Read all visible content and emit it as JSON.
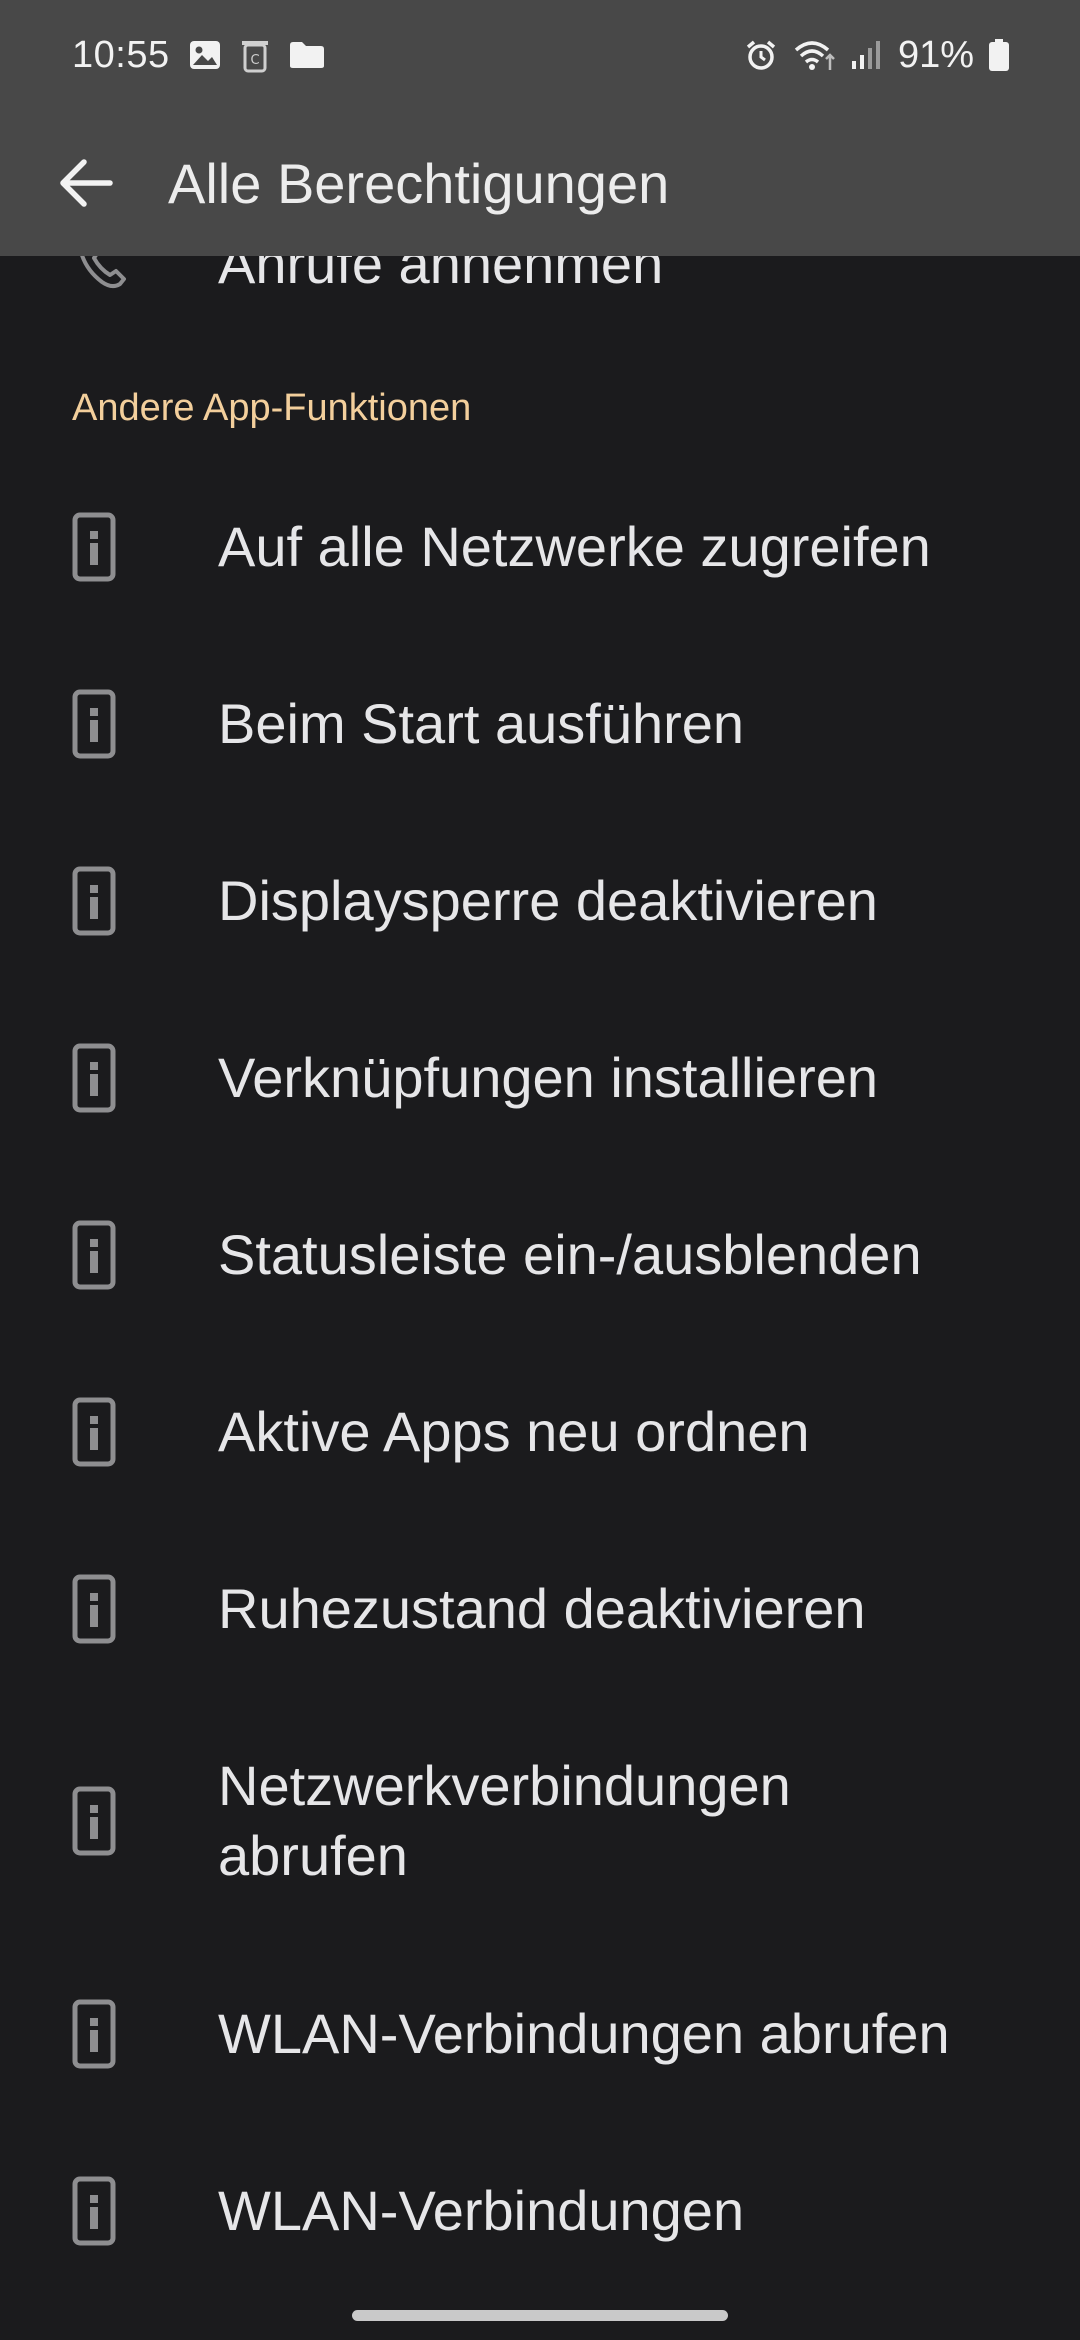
{
  "status_bar": {
    "time": "10:55",
    "battery": "91%",
    "left_icons": [
      "image-icon",
      "recycle-bin-icon",
      "folder-icon"
    ],
    "right_icons": [
      "alarm-icon",
      "wifi-icon",
      "signal-icon",
      "battery-icon"
    ]
  },
  "header": {
    "title": "Alle Berechtigungen",
    "back_icon": "arrow-left-icon"
  },
  "list": {
    "partial_item": {
      "label": "Anrufe annehmen",
      "icon": "phone-icon"
    },
    "section_title": "Andere App-Funktionen",
    "items": [
      {
        "label": "Auf alle Netzwerke zugreifen",
        "icon": "info-device-icon"
      },
      {
        "label": "Beim Start ausführen",
        "icon": "info-device-icon"
      },
      {
        "label": "Displaysperre deaktivieren",
        "icon": "info-device-icon"
      },
      {
        "label": "Verknüpfungen installieren",
        "icon": "info-device-icon"
      },
      {
        "label": "Statusleiste ein-/ausblenden",
        "icon": "info-device-icon"
      },
      {
        "label": "Aktive Apps neu ordnen",
        "icon": "info-device-icon"
      },
      {
        "label": "Ruhezustand deaktivieren",
        "icon": "info-device-icon"
      },
      {
        "label": "Netzwerkverbindungen abrufen",
        "icon": "info-device-icon"
      },
      {
        "label": "WLAN-Verbindungen abrufen",
        "icon": "info-device-icon"
      },
      {
        "label": "WLAN-Verbindungen",
        "icon": "info-device-icon"
      }
    ]
  },
  "colors": {
    "background": "#1b1b1d",
    "app_bar": "#484848",
    "section_accent": "#f3cf9c",
    "text": "#e6e6e8",
    "icon": "#8e8e90"
  }
}
